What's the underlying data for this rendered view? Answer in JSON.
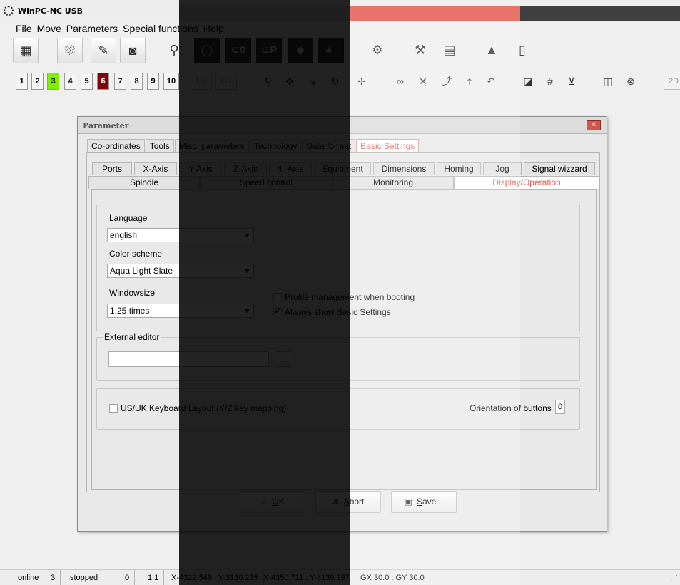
{
  "window": {
    "title": "WinPC-NC USB",
    "close_glyph": "✕"
  },
  "menu": [
    "File",
    "Move",
    "Parameters",
    "Special functions",
    "Help"
  ],
  "toolbar1": {
    "dark_labels": [
      "⊂0",
      "⊂P"
    ]
  },
  "toolbar2": {
    "numbers": [
      "1",
      "2",
      "3",
      "4",
      "5",
      "6",
      "7",
      "8",
      "9",
      "10"
    ],
    "btn_1xx": "1xx",
    "btn_g0": "G0",
    "btn_2d": "2D"
  },
  "dialog": {
    "title": "Parameter",
    "close_glyph": "✕",
    "tabs": [
      "Co-ordinates",
      "Tools",
      "Misc. parameters",
      "Technology",
      "Data format",
      "Basic Settings"
    ],
    "subtabs_row1": [
      "Ports",
      "X-Axis",
      "Y-Axis",
      "Z-Axis",
      "4.-Axis",
      "Equipment",
      "Dimensions",
      "Homing",
      "Jog",
      "Signal wizzard"
    ],
    "subtabs_row2": [
      "Spindle",
      "Speed control",
      "Monitoring",
      "Display/Operation"
    ],
    "language_label": "Language",
    "language_value": "english",
    "color_scheme_label": "Color scheme",
    "color_scheme_value": "Aqua Light Slate",
    "windowsize_label": "Windowsize",
    "windowsize_value": "1,25 times",
    "profile_mgmt_label": "Profile management when booting",
    "always_show_label": "Always show Basic Settings",
    "check_mark": "✔",
    "external_editor_label": "External editor",
    "browse_label": "..",
    "keyboard_layout_label": "US/UK Keyboard Layout (Y/Z key mapping)",
    "orientation_label": "Orientation of buttons",
    "orientation_value": "0",
    "ok_label_u": "O",
    "ok_label_rest": "K",
    "abort_label_u": "A",
    "abort_label_rest": "bort",
    "save_label_u": "S",
    "save_label_rest": "ave..."
  },
  "statusbar": {
    "state": "online",
    "count": "3",
    "run": "stopped",
    "blank": "",
    "zero": "0",
    "scale": "1:1",
    "coords1": "X-4322.549 : Y-3130.235",
    "coords2": "X-4350.711 : Y-3139.197",
    "grid": "GX 30.0 : GY 30.0"
  },
  "colors": {
    "accent_tab": "#e05a4f",
    "band_red": "#e8736b",
    "green_num": "#7ff000",
    "red_num": "#7a0707"
  }
}
